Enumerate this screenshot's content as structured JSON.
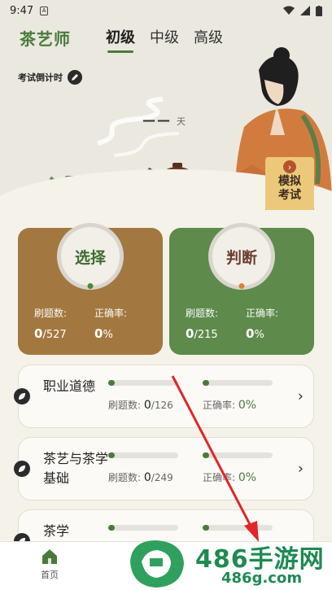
{
  "status_bar": {
    "time": "9:47",
    "notif_letter": "A"
  },
  "header": {
    "brand": "茶艺师",
    "tabs": [
      {
        "label": "初级",
        "active": true
      },
      {
        "label": "中级",
        "active": false
      },
      {
        "label": "高级",
        "active": false
      }
    ]
  },
  "countdown": {
    "label": "考试倒计时",
    "value": "——",
    "unit": "天"
  },
  "mock_exam": {
    "label": "模拟考试"
  },
  "cards": [
    {
      "label": "选择",
      "done_label": "刷题数:",
      "done": "0",
      "total": "/527",
      "acc_label": "正确率:",
      "acc": "0",
      "acc_unit": "%"
    },
    {
      "label": "判断",
      "done_label": "刷题数:",
      "done": "0",
      "total": "/215",
      "acc_label": "正确率:",
      "acc": "0",
      "acc_unit": "%"
    }
  ],
  "chapters": [
    {
      "title": "职业道德",
      "done_label": "刷题数:",
      "done": "0",
      "total": "/126",
      "acc_label": "正确率:",
      "acc": "0%"
    },
    {
      "title": "茶艺与茶学基础",
      "done_label": "刷题数:",
      "done": "0",
      "total": "/249",
      "acc_label": "正确率:",
      "acc": "0%"
    },
    {
      "title": "茶学",
      "done_label": "",
      "done": "",
      "total": "",
      "acc_label": "",
      "acc": ""
    }
  ],
  "bottom_nav": {
    "home": "首页"
  },
  "watermark": {
    "title": "486手游网",
    "sub": "486g.com"
  },
  "colors": {
    "brand_green": "#4a7a3c",
    "choice_card": "#a37840",
    "judge_card": "#5e8a4c",
    "watermark_green": "#1f8a52"
  }
}
